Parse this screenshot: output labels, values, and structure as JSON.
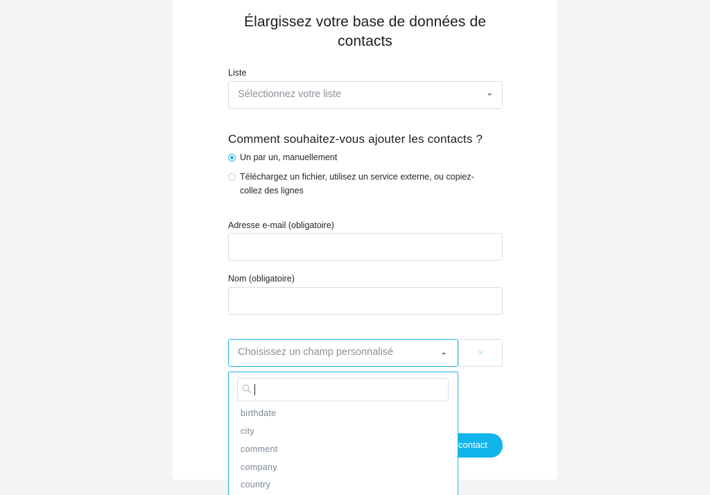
{
  "form": {
    "title_line1": "Élargissez votre base de données de",
    "title_line2": "contacts",
    "list_label": "Liste",
    "list_placeholder": "Sélectionnez votre liste",
    "method_heading": "Comment souhaitez-vous ajouter les contacts ?",
    "option_manual": "Un par un, manuellement",
    "option_upload_line1": "Téléchargez un fichier, utilisez un service externe, ou copiez-",
    "option_upload_line2": "collez des lignes",
    "selected_option": "manual",
    "email_label": "Adresse e-mail (obligatoire)",
    "email_value": "",
    "name_label": "Nom (obligatoire)",
    "name_value": "",
    "custom_field_placeholder": "Choisissez un champ personnalisé",
    "remove_label": "×",
    "submit_label": "contact"
  },
  "dropdown": {
    "search_value": "",
    "options": [
      "birthdate",
      "city",
      "comment",
      "company",
      "country"
    ]
  },
  "colors": {
    "accent": "#1eb4e6",
    "button": "#11b5ec",
    "background": "#f3f4f6"
  }
}
